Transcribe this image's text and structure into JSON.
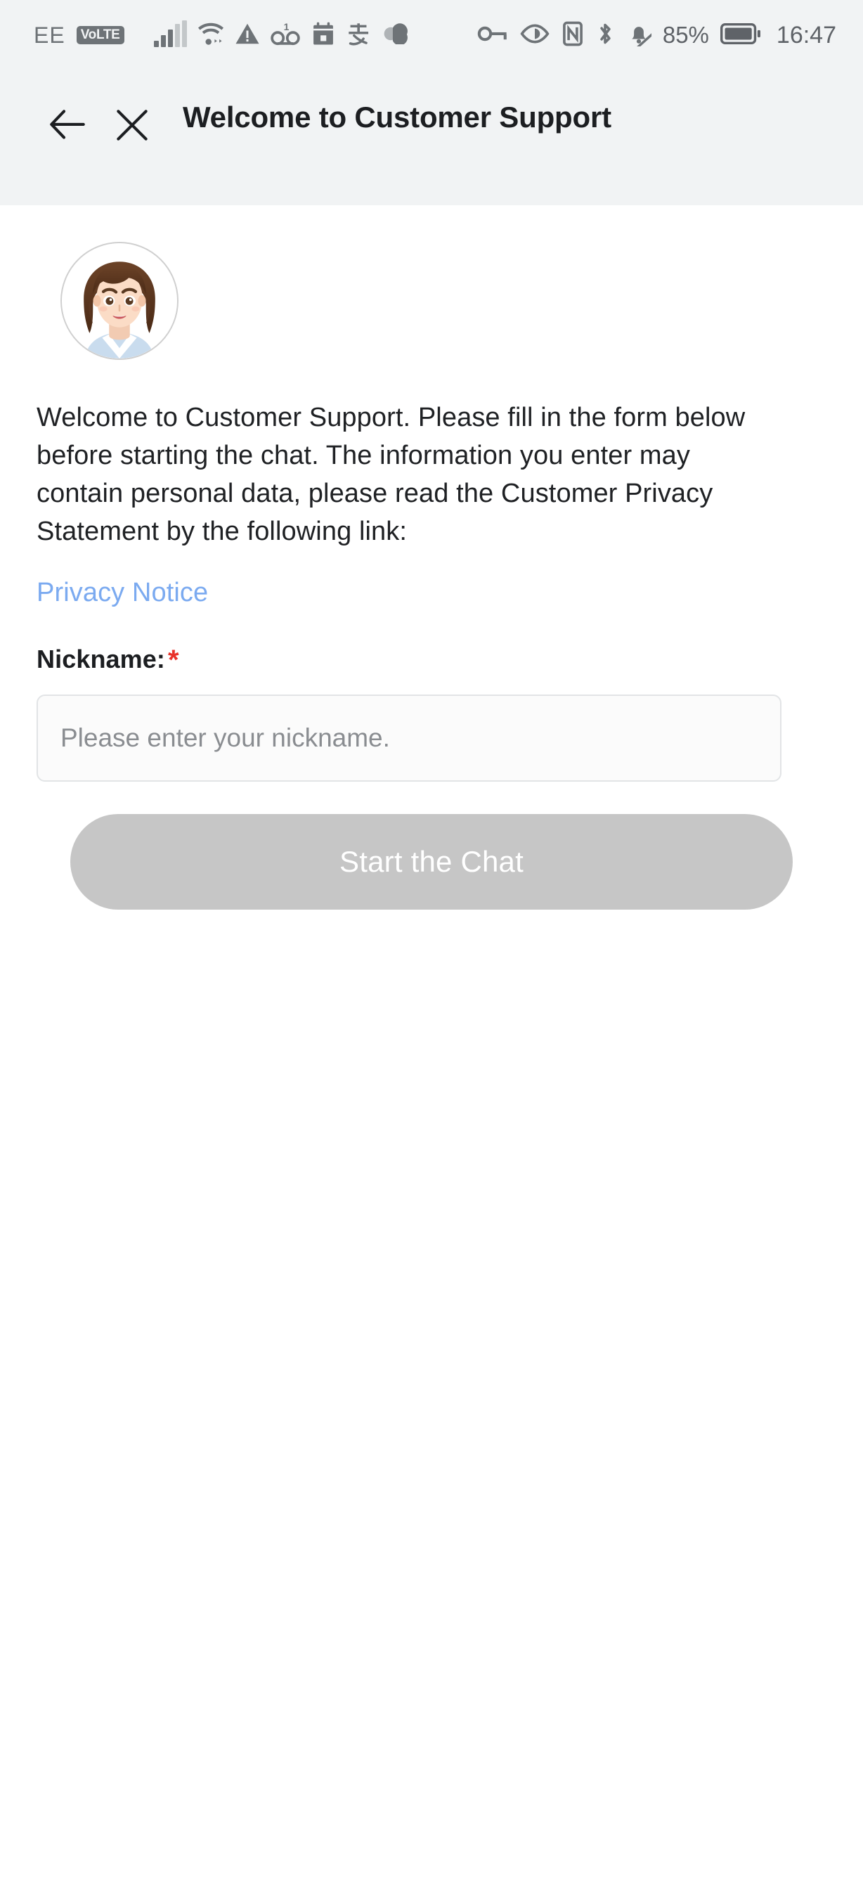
{
  "status_bar": {
    "carrier": "EE",
    "volte_badge": "VoLTE",
    "battery_percent": "85%",
    "time": "16:47",
    "left_icons": [
      "carrier-label",
      "volte-badge",
      "signal-bars-icon",
      "wifi-icon",
      "warning-triangle-icon",
      "voicemail-icon",
      "calendar-icon",
      "alipay-icon",
      "cloud-icon"
    ],
    "right_icons": [
      "vpn-key-icon",
      "eye-comfort-icon",
      "nfc-icon",
      "bluetooth-icon",
      "silent-bell-icon",
      "battery-icon"
    ],
    "voicemail_badge_count": "1",
    "colors": {
      "background": "#F1F3F4",
      "icon": "#6E7377",
      "text": "#5F6368"
    }
  },
  "header": {
    "title": "Welcome to Customer Support",
    "back_icon": "arrow-left-icon",
    "close_icon": "close-icon",
    "background": "#F1F3F4"
  },
  "main": {
    "avatar_alt": "support-agent-avatar",
    "intro_paragraph": "Welcome to Customer Support. Please fill in the form below before starting the chat. The information you enter may contain personal data, please read the Customer Privacy Statement by the following link:",
    "privacy_link_label": "Privacy Notice",
    "privacy_link_color": "#7BAAF0",
    "form": {
      "nickname_label": "Nickname:",
      "required_marker": "*",
      "required_marker_color": "#E8322A",
      "nickname_value": "",
      "nickname_placeholder": "Please enter your nickname."
    },
    "submit_button": {
      "label": "Start the Chat",
      "enabled": false,
      "background": "#C6C6C6",
      "text_color": "#FFFFFF"
    }
  }
}
